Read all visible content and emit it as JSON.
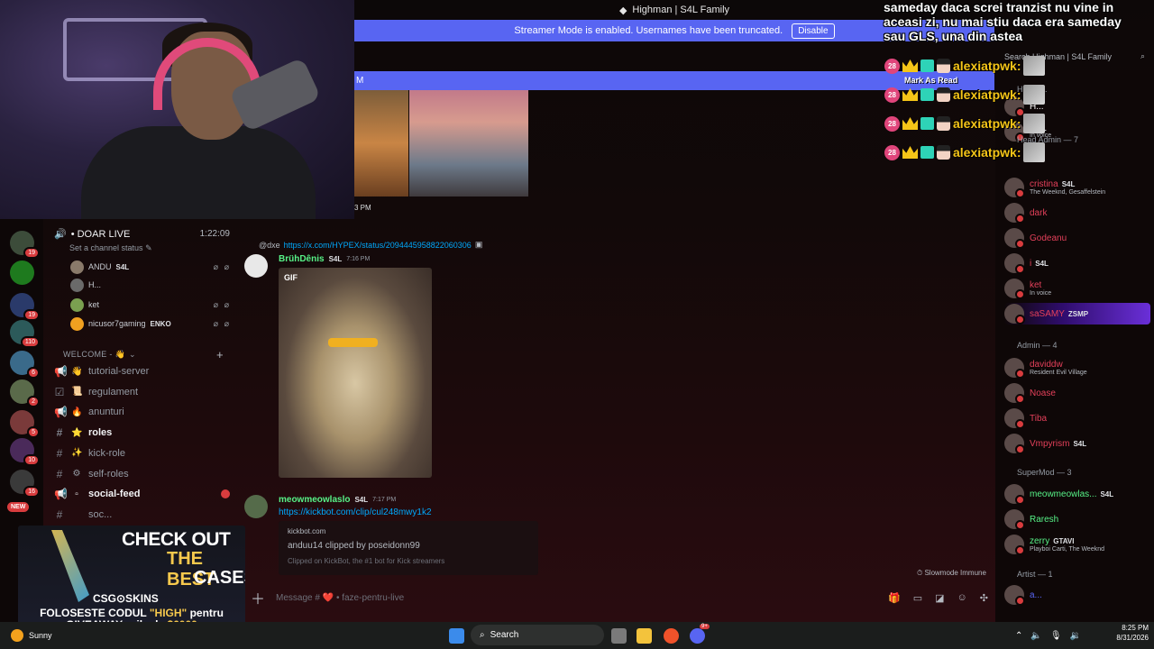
{
  "window": {
    "title": "Highman | S4L Family"
  },
  "streamer_banner": {
    "text": "Streamer Mode is enabled. Usernames have been truncated.",
    "button": "Disable"
  },
  "new_messages": {
    "left": "M",
    "right": "Mark As Read"
  },
  "overlay": {
    "message": "sameday daca screi tranzist nu vine in aceasi zi, nu mai stiu daca era sameday sau GLS, una din astea",
    "chatter": "alexiatpwk:",
    "badge_count": "28",
    "accent": "#f5c518"
  },
  "voice": {
    "channel": "• DOAR LIVE",
    "time": "1:22:09",
    "status": "Set a channel status",
    "users": [
      {
        "name": "ANDU",
        "tag": "S4L",
        "icons": "⌀ ⌀"
      },
      {
        "name": "H...",
        "tag": "",
        "icons": ""
      },
      {
        "name": "ket",
        "tag": "",
        "icons": "⌀ ⌀"
      },
      {
        "name": "nicusor7gaming",
        "tag": "ENKO",
        "icons": "⌀ ⌀"
      }
    ]
  },
  "category": {
    "label": "WELCOME - 👋",
    "plus": "+"
  },
  "channels": [
    {
      "name": "tutorial-server",
      "emoji": "👋",
      "icon": "📢",
      "bold": false
    },
    {
      "name": "regulament",
      "emoji": "📜",
      "icon": "☑",
      "bold": false
    },
    {
      "name": "anunturi",
      "emoji": "🔥",
      "icon": "📢",
      "bold": false
    },
    {
      "name": "roles",
      "emoji": "⭐",
      "icon": "#",
      "bold": true
    },
    {
      "name": "kick-role",
      "emoji": "✨",
      "icon": "#",
      "bold": false
    },
    {
      "name": "self-roles",
      "emoji": "⚙",
      "icon": "#",
      "bold": false
    },
    {
      "name": "social-feed",
      "emoji": "▫",
      "icon": "📢",
      "bold": true
    },
    {
      "name": "soc...",
      "emoji": "",
      "icon": "#",
      "bold": false
    }
  ],
  "servers": [
    {
      "badge": "19"
    },
    {
      "badge": ""
    },
    {
      "badge": "19"
    },
    {
      "badge": "110"
    },
    {
      "badge": "6"
    },
    {
      "badge": "2"
    },
    {
      "badge": "5"
    },
    {
      "badge": "10"
    },
    {
      "badge": "16"
    }
  ],
  "ad": {
    "line1": "CHECK OUT",
    "line2": "THE BEST",
    "line3": "CASES",
    "brand": "CSG⊙SKINS",
    "promo_a": "FOLOSESTE CODUL ",
    "promo_code": "\"HIGH\"",
    "promo_b": " pentru",
    "promo_c": "GIVEAWAY-urile de ",
    "promo_amount": "$6000",
    "new_badge": "NEW"
  },
  "messages": {
    "prev_time": "3 PM",
    "reply_user": "@dxe",
    "reply_link": "https://x.com/HYPEX/status/2094445958822060306",
    "m1": {
      "author": "BrühDênis",
      "tag": "S4L",
      "time": "7:16 PM",
      "gif_label": "GIF",
      "color": "#57f287"
    },
    "m2": {
      "author": "meowmeowlaslo",
      "tag": "S4L",
      "time": "7:17 PM",
      "link": "https://kickbot.com/clip/cul248mwy1k2",
      "color": "#57f287"
    },
    "embed": {
      "provider": "kickbot.com",
      "title": "anduu14 clipped by poseidonn99",
      "desc": "Clipped on KickBot, the #1 bot for Kick streamers"
    },
    "slowmode": "Slowmode Immune"
  },
  "input": {
    "placeholder": "Message # ❤️ • faze-pentru-live"
  },
  "search": {
    "placeholder": "Search Highman | S4L Family"
  },
  "members": {
    "groups": {
      "head_admin": "Head Admin — 7",
      "admin": "Admin — 4",
      "supermod": "SuperMod — 3",
      "artist": "Artist — 1",
      "highman": "Highm..."
    },
    "head_admins": [
      {
        "name": "H...",
        "sub": "",
        "color": "#ffffff",
        "tag": ""
      },
      {
        "name": "",
        "sub": "In voice",
        "color": "#ffffff",
        "tag": "S4L"
      },
      {
        "name": "cristina",
        "sub": "The Weeknd, Gesaffelstein",
        "color": "#e3405a",
        "tag": "S4L"
      },
      {
        "name": "dark",
        "sub": "",
        "color": "#e3405a",
        "tag": ""
      },
      {
        "name": "Godeanu",
        "sub": "",
        "color": "#e3405a",
        "tag": ""
      },
      {
        "name": "i",
        "sub": "",
        "color": "#e3405a",
        "tag": "S4L"
      },
      {
        "name": "ket",
        "sub": "In voice",
        "color": "#e3405a",
        "tag": ""
      },
      {
        "name": "saSAMY",
        "sub": "",
        "color": "#e3405a",
        "tag": "ZSMP"
      }
    ],
    "admins": [
      {
        "name": "daviddw",
        "sub": "Resident Evil Village",
        "color": "#e3405a",
        "tag": ""
      },
      {
        "name": "Noase",
        "sub": "",
        "color": "#e3405a",
        "tag": ""
      },
      {
        "name": "Tiba",
        "sub": "",
        "color": "#e3405a",
        "tag": ""
      },
      {
        "name": "Vmpyrism",
        "sub": "",
        "color": "#e3405a",
        "tag": "S4L"
      }
    ],
    "supermods": [
      {
        "name": "meowmeowlas...",
        "sub": "",
        "color": "#57f287",
        "tag": "S4L"
      },
      {
        "name": "Raresh",
        "sub": "",
        "color": "#57f287",
        "tag": ""
      },
      {
        "name": "zerry",
        "sub": "Playboi Carti, The Weeknd",
        "color": "#57f287",
        "tag": "GTAVI"
      }
    ],
    "artists": [
      {
        "name": "a...",
        "sub": "",
        "color": "#5865f2",
        "tag": ""
      }
    ]
  },
  "taskbar": {
    "weather": "Sunny",
    "search": "Search",
    "time": "8:25 PM",
    "date": "8/31/2026",
    "discord_badge": "9+"
  }
}
